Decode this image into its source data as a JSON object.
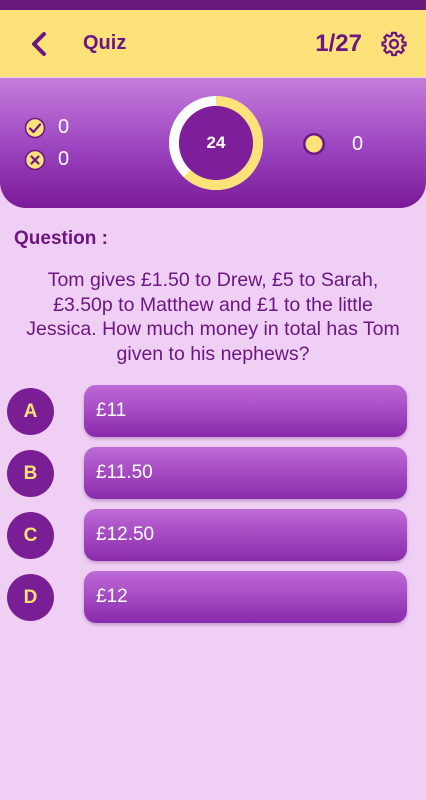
{
  "header": {
    "title": "Quiz",
    "counter": "1/27"
  },
  "stats": {
    "correct": "0",
    "wrong": "0",
    "coins": "0"
  },
  "timer": {
    "value": "24",
    "progress": 0.62
  },
  "question": {
    "label": "Question :",
    "text": "Tom gives £1.50 to Drew, £5 to Sarah, £3.50p to Matthew and £1 to the little Jessica. How much money in total has Tom given to his nephews?"
  },
  "options": [
    {
      "letter": "A",
      "text": "£11"
    },
    {
      "letter": "B",
      "text": "£11.50"
    },
    {
      "letter": "C",
      "text": "£12.50"
    },
    {
      "letter": "D",
      "text": "£12"
    }
  ],
  "colors": {
    "primary": "#6d1683",
    "accent": "#fde27a",
    "background": "#efcff3"
  },
  "icons": {
    "back": "back-arrow-icon",
    "settings": "gear-icon",
    "correct": "check-circle-icon",
    "wrong": "x-circle-icon",
    "coin": "coin-icon"
  }
}
